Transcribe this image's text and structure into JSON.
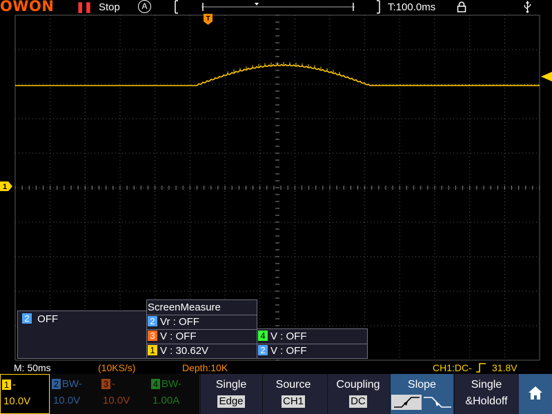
{
  "topbar": {
    "logo": "OWON",
    "run_state": "Stop",
    "acq_mode_icon": "A",
    "timebase": "T:100.0ms",
    "lock_icon": "lock-icon",
    "usb_icon": "usb-icon",
    "accent_color": "#ff5a00",
    "pause_color": "#ff3333"
  },
  "screen": {
    "trigger_marker": "T",
    "channel1_marker": "1",
    "trace_color": "#ffcc00",
    "grid_color": "#5c5c5c"
  },
  "ch2_panel": {
    "badge": "2",
    "text": "OFF"
  },
  "screen_measure": {
    "title": "ScreenMeasure",
    "rows": [
      {
        "badge": "2",
        "text": "Vr : OFF"
      },
      {
        "badge": "3",
        "text": "V : OFF"
      },
      {
        "badge": "1",
        "text": "V : 30.62V"
      }
    ],
    "right_rows": [
      {
        "badge": "4",
        "text": "V : OFF"
      },
      {
        "badge": "2",
        "text": "V : OFF"
      }
    ]
  },
  "statusline": {
    "main_time": "M: 50ms",
    "sample_rate": "(10KS/s)",
    "depth": "Depth:10K",
    "trigger_info": "CH1:DC-",
    "trigger_level": "31.8V"
  },
  "channels": [
    {
      "num": "1",
      "label": "-",
      "scale": "10.0V",
      "color": "#ffd400"
    },
    {
      "num": "2",
      "label": "BW-",
      "scale": "10.0V",
      "color": "#3f7fd0"
    },
    {
      "num": "3",
      "label": "-",
      "scale": "10.0V",
      "color": "#d0551a"
    },
    {
      "num": "4",
      "label": "BW-",
      "scale": "1.00A",
      "color": "#2aa52a"
    }
  ],
  "softkeys": {
    "single": {
      "title": "Single",
      "value": "Edge"
    },
    "source": {
      "title": "Source",
      "value": "CH1"
    },
    "coupling": {
      "title": "Coupling",
      "value": "DC"
    },
    "slope": {
      "title": "Slope"
    },
    "holdoff": {
      "title": "Single",
      "value": "&Holdoff"
    }
  },
  "home_icon": "home-icon"
}
